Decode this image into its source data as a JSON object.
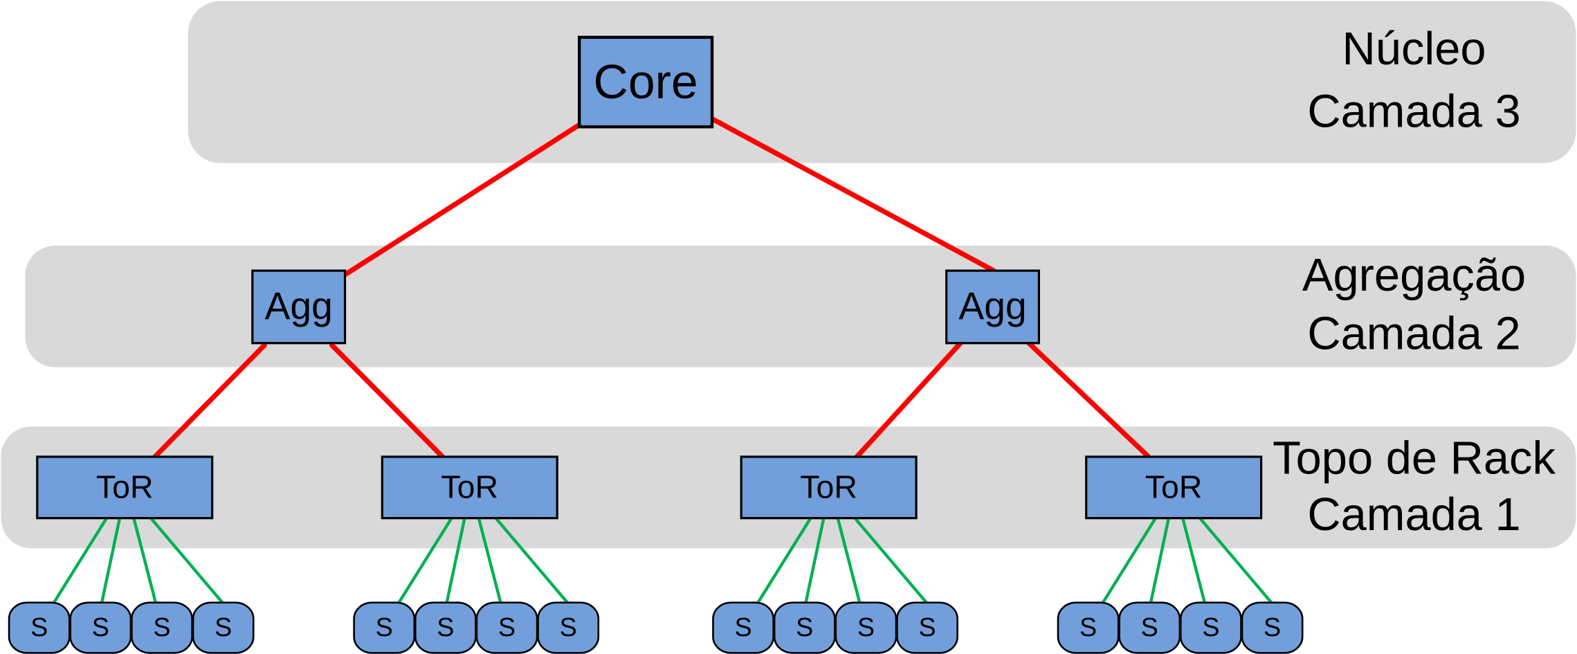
{
  "colors": {
    "band": "#d9d9d9",
    "node_fill": "#729fdb",
    "uplink": "#ff0000",
    "server_link": "#00b050"
  },
  "layers": [
    {
      "name": "Núcleo",
      "level": "Camada 3"
    },
    {
      "name": "Agregação",
      "level": "Camada 2"
    },
    {
      "name": "Topo de Rack",
      "level": "Camada 1"
    }
  ],
  "nodes": {
    "core": {
      "label": "Core"
    },
    "aggregation": [
      {
        "label": "Agg"
      },
      {
        "label": "Agg"
      }
    ],
    "tor": [
      {
        "label": "ToR",
        "parent_agg": 0
      },
      {
        "label": "ToR",
        "parent_agg": 0
      },
      {
        "label": "ToR",
        "parent_agg": 1
      },
      {
        "label": "ToR",
        "parent_agg": 1
      }
    ],
    "servers_per_tor": 4,
    "server_label": "S"
  }
}
